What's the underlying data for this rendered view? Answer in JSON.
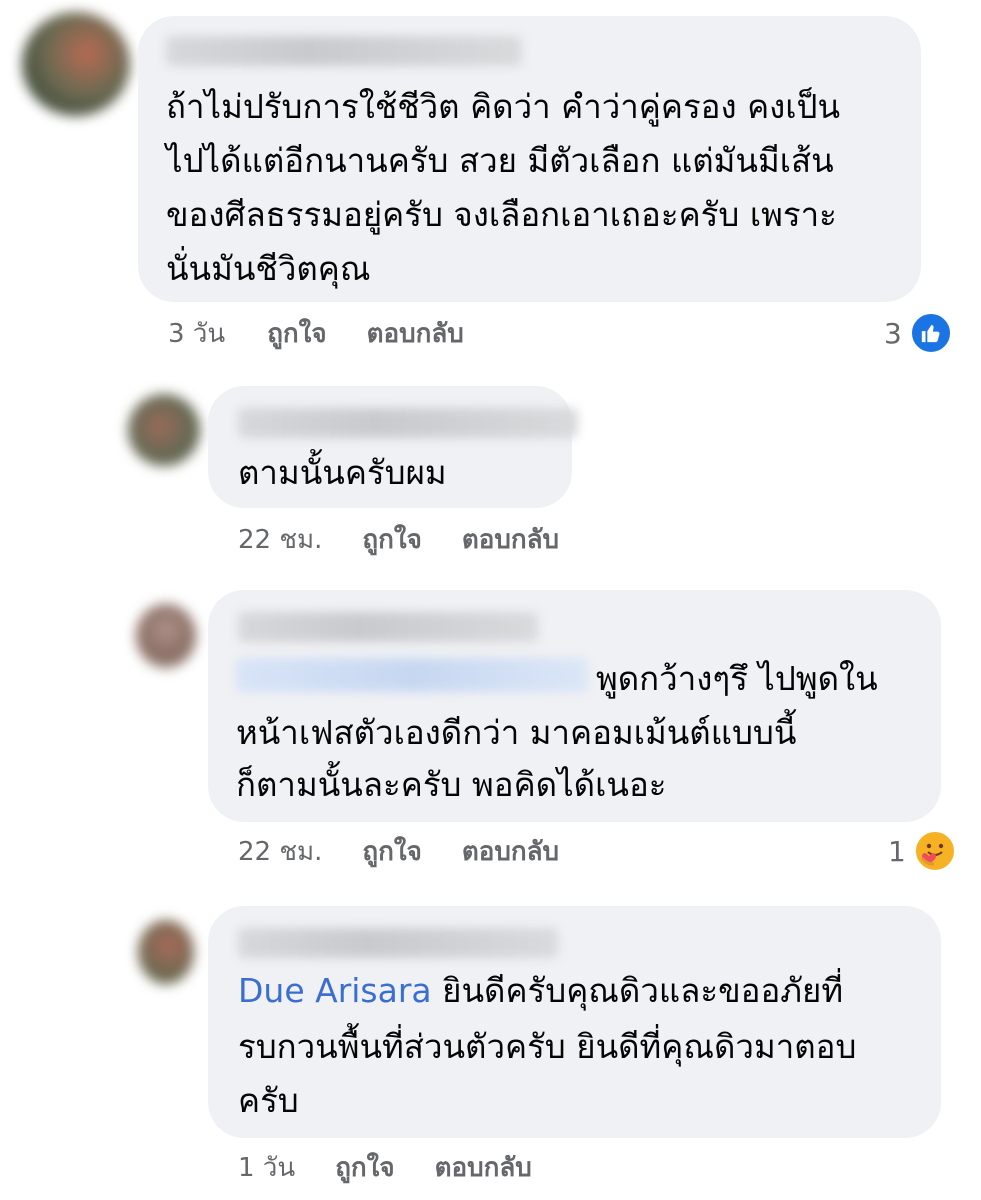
{
  "comments": [
    {
      "lines": [
        "ถ้าไม่ปรับการใช้ชีวิต คิดว่า คำว่าคู่ครอง คงเป็น",
        "ไปได้แต่อีกนานครับ สวย มีตัวเลือก แต่มันมีเส้น",
        "ของศีลธรรมอยู่ครับ จงเลือกเอาเถอะครับ เพราะ",
        "นั่นมันชีวิตคุณ"
      ],
      "time": "3 วัน",
      "like_label": "ถูกใจ",
      "reply_label": "ตอบกลับ",
      "reaction_count": "3",
      "reaction_icon": "like-icon"
    },
    {
      "lines": [
        "ตามนั้นครับผม"
      ],
      "time": "22 ชม.",
      "like_label": "ถูกใจ",
      "reply_label": "ตอบกลับ"
    },
    {
      "lines": [
        "พูดกว้างๆรึ ไปพูดใน",
        "หน้าเฟสตัวเองดีกว่า มาคอมเม้นต์แบบนี้",
        "ก็ตามนั้นละครับ พอคิดได้เนอะ"
      ],
      "time": "22 ชม.",
      "like_label": "ถูกใจ",
      "reply_label": "ตอบกลับ",
      "reaction_count": "1",
      "reaction_icon": "care-icon"
    },
    {
      "mention": "Due Arisara",
      "lines": [
        " ยินดีครับคุณดิวและขออภัยที่",
        "รบกวนพื้นที่ส่วนตัวครับ ยินดีที่คุณดิวมาตอบ",
        "ครับ"
      ],
      "time": "1 วัน",
      "like_label": "ถูกใจ",
      "reply_label": "ตอบกลับ"
    }
  ],
  "colors": {
    "bubble": "#f0f1f4",
    "meta_text": "#65676b",
    "mention": "#3a6fd0",
    "like": "#1b74e4",
    "care": "#f7b125"
  }
}
